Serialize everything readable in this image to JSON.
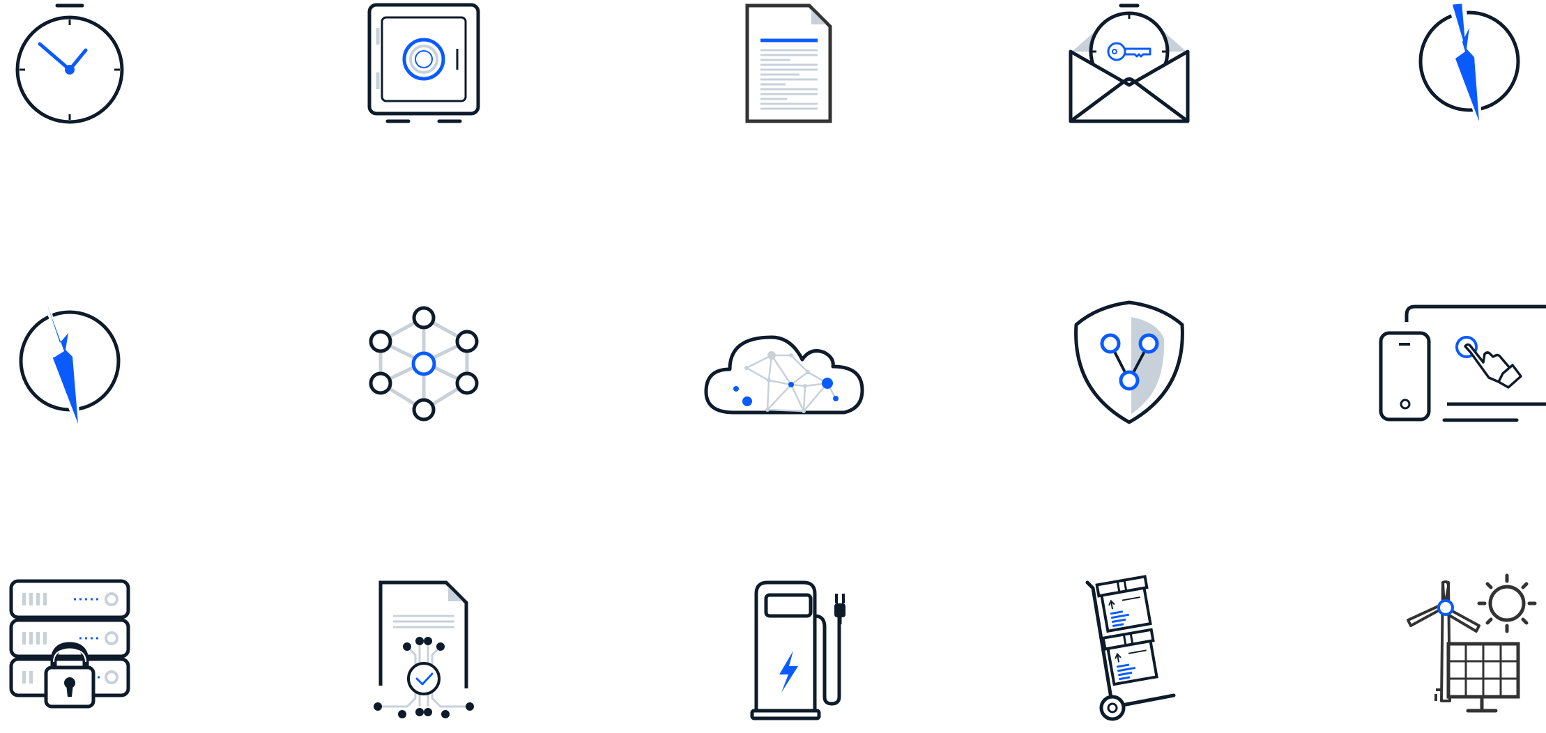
{
  "colors": {
    "ink": "#0d1b2a",
    "accent": "#0a5bff",
    "muted": "#c8d1da",
    "background": "#ffffff"
  },
  "icons": [
    {
      "id": "stopwatch-icon"
    },
    {
      "id": "safe-icon"
    },
    {
      "id": "document-icon"
    },
    {
      "id": "timed-email-key-icon"
    },
    {
      "id": "power-bolt-icon"
    },
    {
      "id": "power-bolt-icon"
    },
    {
      "id": "network-nodes-icon"
    },
    {
      "id": "cloud-network-icon"
    },
    {
      "id": "security-shield-icon"
    },
    {
      "id": "touch-devices-icon"
    },
    {
      "id": "secure-server-icon"
    },
    {
      "id": "verified-document-icon"
    },
    {
      "id": "ev-charging-station-icon"
    },
    {
      "id": "hand-truck-boxes-icon"
    },
    {
      "id": "renewable-energy-icon"
    }
  ]
}
